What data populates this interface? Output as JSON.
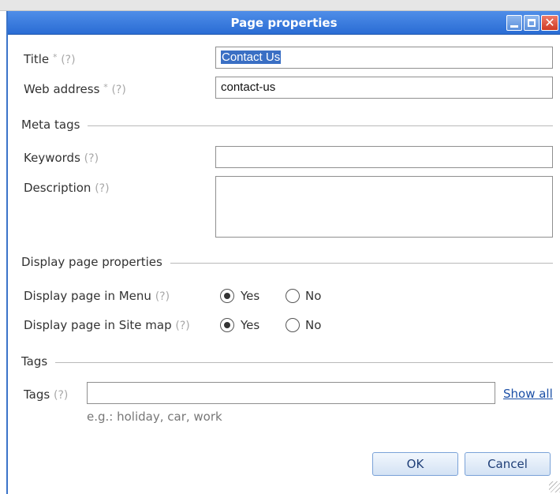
{
  "window": {
    "title": "Page properties"
  },
  "fields": {
    "title": {
      "label": "Title",
      "required": "*",
      "help": "(?)",
      "value": "Contact Us"
    },
    "web_address": {
      "label": "Web address",
      "required": "*",
      "help": "(?)",
      "value": "contact-us"
    }
  },
  "meta_tags": {
    "heading": "Meta tags",
    "keywords": {
      "label": "Keywords",
      "help": "(?)",
      "value": ""
    },
    "description": {
      "label": "Description",
      "help": "(?)",
      "value": ""
    }
  },
  "display": {
    "heading": "Display page properties",
    "menu": {
      "label": "Display page in Menu",
      "help": "(?)",
      "yes": "Yes",
      "no": "No",
      "selected": "Yes"
    },
    "sitemap": {
      "label": "Display page in Site map",
      "help": "(?)",
      "yes": "Yes",
      "no": "No",
      "selected": "Yes"
    }
  },
  "tags": {
    "heading": "Tags",
    "label": "Tags",
    "help": "(?)",
    "value": "",
    "show_all": "Show all",
    "hint": "e.g.: holiday, car, work"
  },
  "buttons": {
    "ok": "OK",
    "cancel": "Cancel"
  },
  "colors": {
    "titlebar": "#2a6cd4",
    "selection": "#3a6fc4",
    "link": "#1b4fa6"
  }
}
